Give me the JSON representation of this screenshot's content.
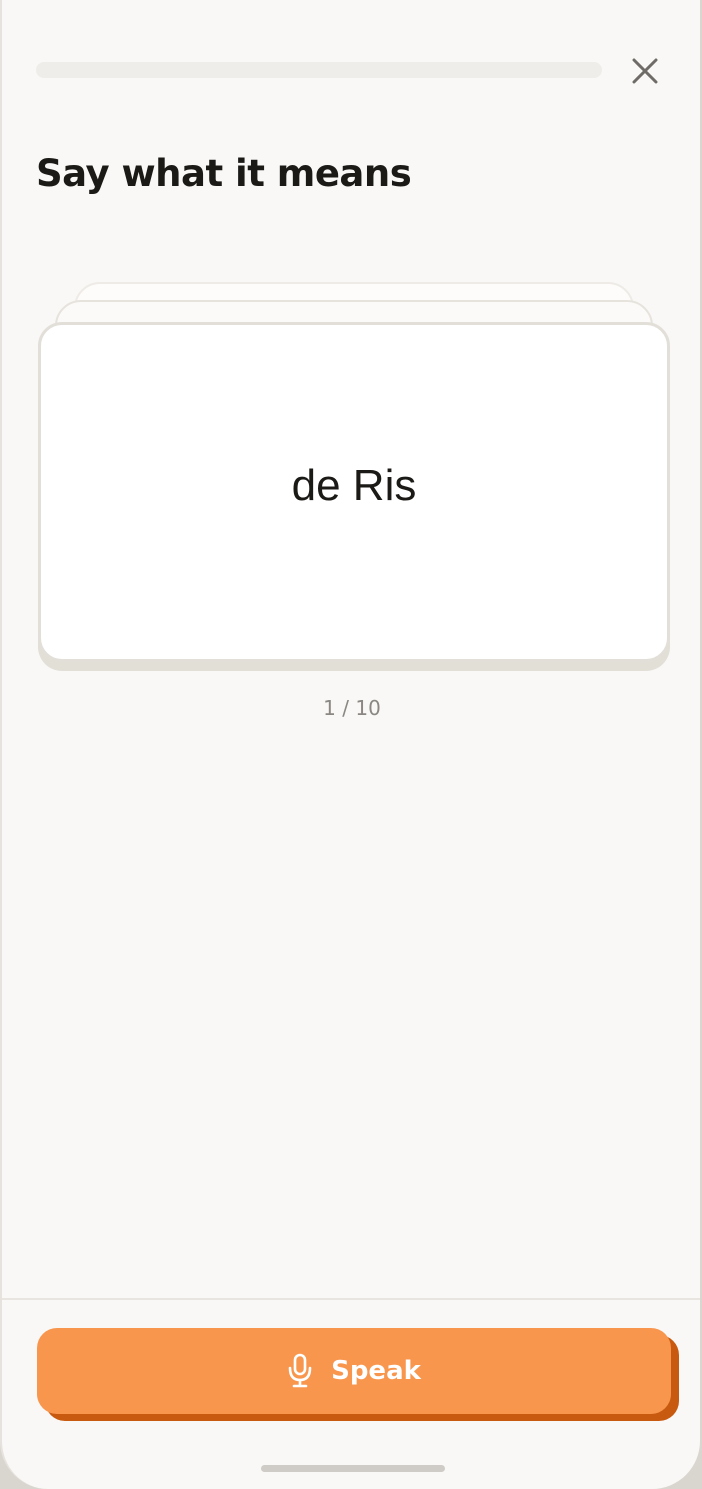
{
  "progress": {
    "fraction": 0
  },
  "header": {
    "title": "Say what it means"
  },
  "card": {
    "word": "de Ris"
  },
  "counter": {
    "text": "1 / 10"
  },
  "speak_button": {
    "label": "Speak",
    "icon": "microphone-icon"
  },
  "colors": {
    "accent": "#f8964e",
    "accent_shadow": "#c85a10",
    "background": "#f9f8f6",
    "text": "#1c1a17"
  }
}
